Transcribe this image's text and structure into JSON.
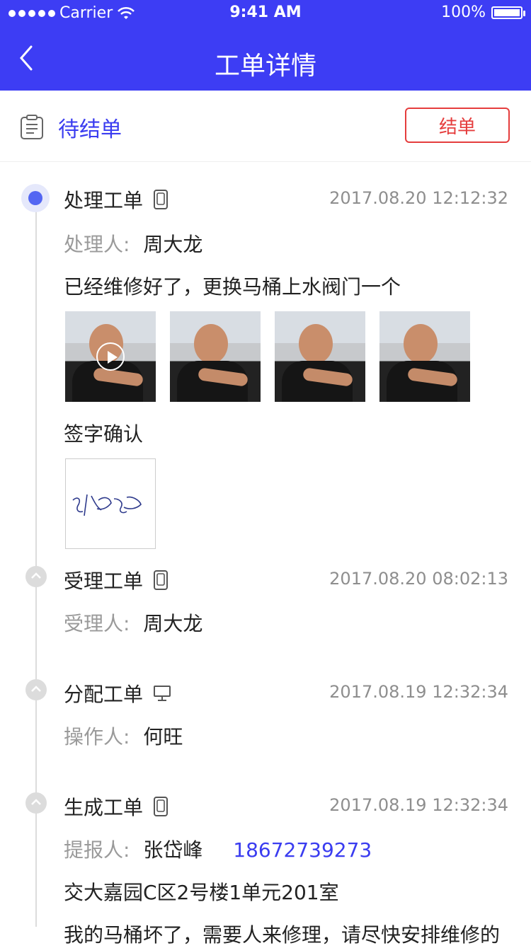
{
  "status_bar": {
    "carrier": "Carrier",
    "time": "9:41 AM",
    "battery": "100%"
  },
  "nav": {
    "title": "工单详情"
  },
  "ticket_status": {
    "label": "待结单",
    "action": "结单"
  },
  "steps": [
    {
      "title": "处理工单",
      "device_icon": "phone-icon",
      "time": "2017.08.20 12:12:32",
      "person_label": "处理人:",
      "person": "周大龙",
      "note": "已经维修好了，更换马桶上水阀门一个",
      "media": [
        {
          "type": "video"
        },
        {
          "type": "photo"
        },
        {
          "type": "photo"
        },
        {
          "type": "photo"
        }
      ],
      "signature_label": "签字确认"
    },
    {
      "title": "受理工单",
      "device_icon": "phone-icon",
      "time": "2017.08.20 08:02:13",
      "person_label": "受理人:",
      "person": "周大龙"
    },
    {
      "title": "分配工单",
      "device_icon": "desktop-icon",
      "time": "2017.08.19 12:32:34",
      "person_label": "操作人:",
      "person": "何旺"
    },
    {
      "title": "生成工单",
      "device_icon": "phone-icon",
      "time": "2017.08.19 12:32:34",
      "person_label": "提报人:",
      "person": "张岱峰",
      "phone": "18672739273",
      "address": "交大嘉园C区2号楼1单元201室",
      "description": "我的马桶坏了，需要人来修理，请尽快安排维修的"
    }
  ],
  "colors": {
    "brand": "#3d3df4",
    "accent_red": "#e53d3d",
    "active_dot": "#5366f2"
  }
}
